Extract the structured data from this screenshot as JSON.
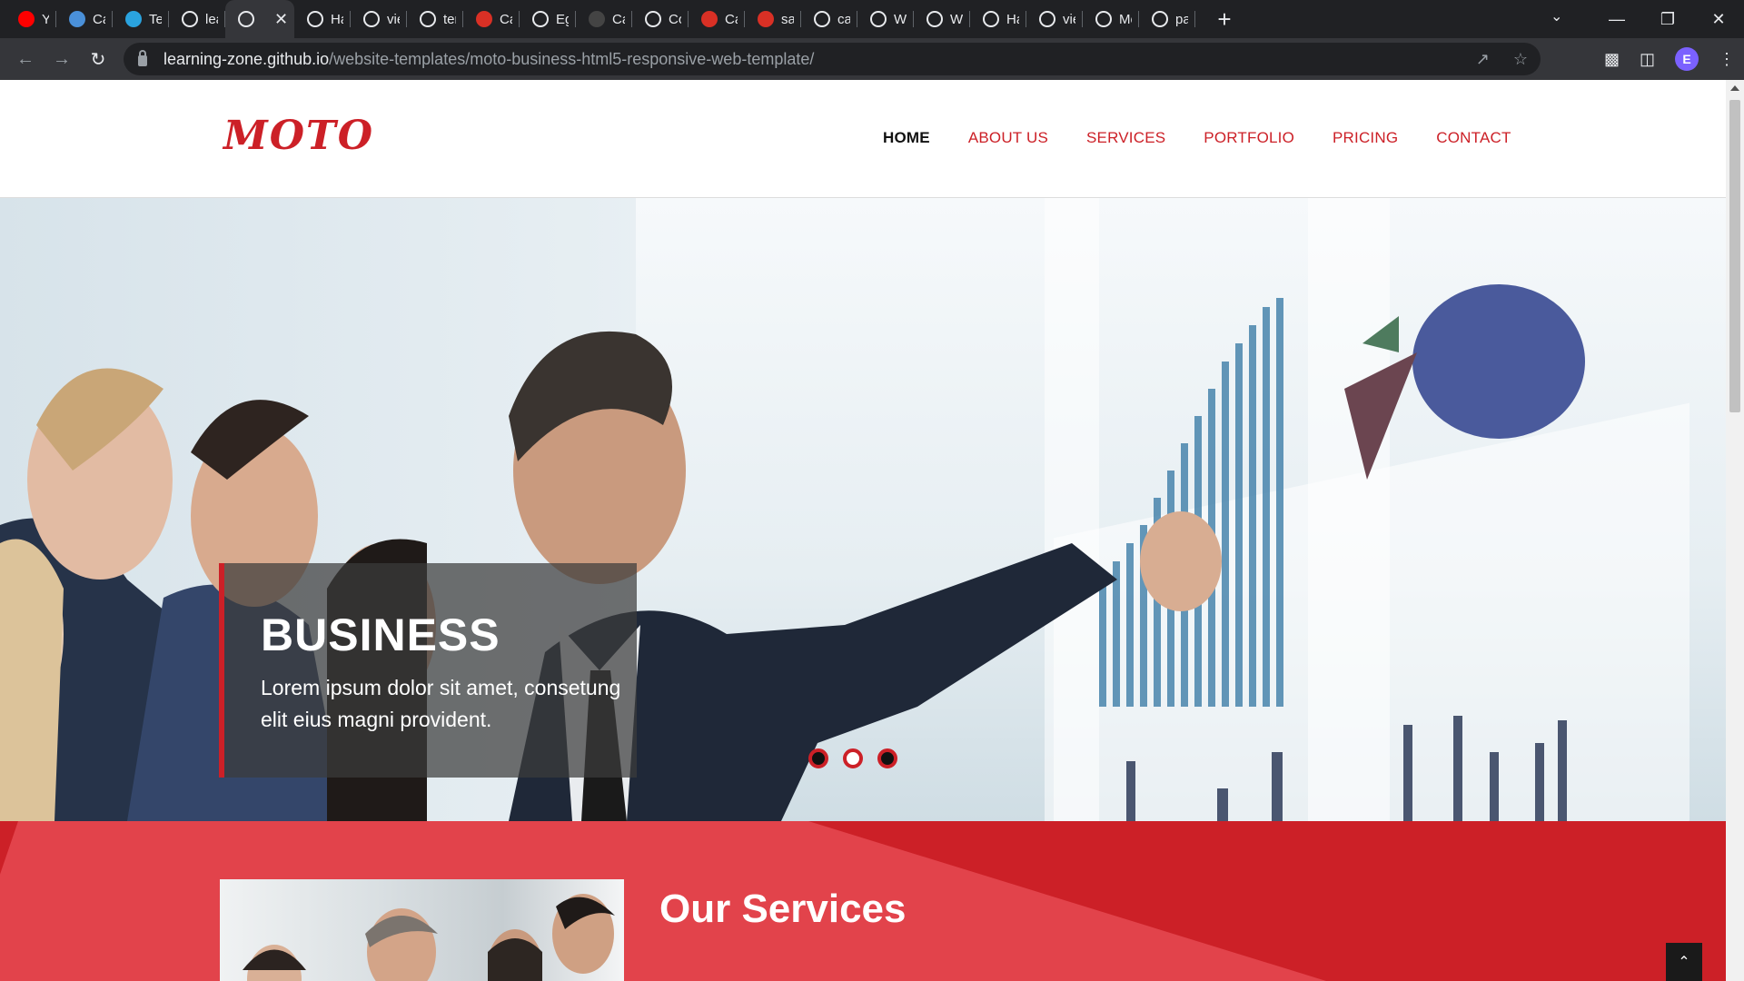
{
  "browser": {
    "tabs": [
      {
        "title": "You",
        "icon": "youtube-icon",
        "color": "#ff0000"
      },
      {
        "title": "Car",
        "icon": "chart-favicon-icon",
        "color": "#4a90d9"
      },
      {
        "title": "Tele",
        "icon": "telegram-icon",
        "color": "#2aa3df"
      },
      {
        "title": "lear",
        "icon": "github-icon",
        "color": "#ffffff"
      },
      {
        "title": "",
        "icon": "globe-icon",
        "color": "#ffffff",
        "active": true
      },
      {
        "title": "Hal",
        "icon": "globe-icon",
        "color": "#ffffff"
      },
      {
        "title": "viev",
        "icon": "globe-icon",
        "color": "#ffffff"
      },
      {
        "title": "tem",
        "icon": "google-icon",
        "color": "#ffffff"
      },
      {
        "title": "Car",
        "icon": "pin-icon",
        "color": "#d93025"
      },
      {
        "title": "Egy",
        "icon": "github-icon",
        "color": "#ffffff"
      },
      {
        "title": "Car",
        "icon": "dark-favicon-icon",
        "color": "#444444"
      },
      {
        "title": "Cou",
        "icon": "tn-icon",
        "color": "#ffffff"
      },
      {
        "title": "Car",
        "icon": "pin-icon",
        "color": "#d93025"
      },
      {
        "title": "sam",
        "icon": "pin-icon",
        "color": "#d93025"
      },
      {
        "title": "cara",
        "icon": "google-icon",
        "color": "#ffffff"
      },
      {
        "title": "Wel",
        "icon": "github-icon",
        "color": "#ffffff"
      },
      {
        "title": "Wel",
        "icon": "github-icon",
        "color": "#ffffff"
      },
      {
        "title": "Hal",
        "icon": "globe-icon",
        "color": "#ffffff"
      },
      {
        "title": "viev",
        "icon": "globe-icon",
        "color": "#ffffff"
      },
      {
        "title": "Mer",
        "icon": "check-favicon-icon",
        "color": "#ffffff"
      },
      {
        "title": "pac",
        "icon": "google-icon",
        "color": "#ffffff"
      }
    ],
    "url_host": "learning-zone.github.io",
    "url_path": "/website-templates/moto-business-html5-responsive-web-template/",
    "profile_initial": "E"
  },
  "site": {
    "logo": "MOTO",
    "nav": [
      "HOME",
      "ABOUT US",
      "SERVICES",
      "PORTFOLIO",
      "PRICING",
      "CONTACT"
    ],
    "active_nav": "HOME",
    "hero": {
      "title": "BUSINESS",
      "text": "Lorem ipsum dolor sit amet, consetung elit eius magni provident.",
      "slides": 3,
      "active_slide": 2
    },
    "services_title": "Our Services"
  },
  "colors": {
    "brand_red": "#cc2027",
    "light_red": "#e2434b"
  }
}
